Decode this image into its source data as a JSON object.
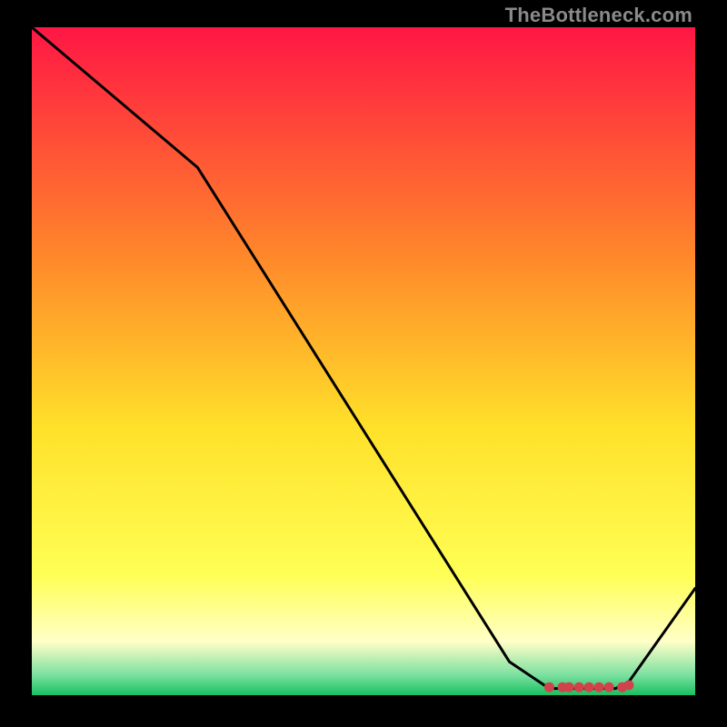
{
  "watermark": "TheBottleneck.com",
  "chart_data": {
    "type": "line",
    "title": "",
    "xlabel": "",
    "ylabel": "",
    "xlim": [
      0,
      100
    ],
    "ylim": [
      0,
      100
    ],
    "grid": false,
    "legend": false,
    "gradient_stops": [
      {
        "offset": 0,
        "color": "#ff1644"
      },
      {
        "offset": 0.35,
        "color": "#ff8a2a"
      },
      {
        "offset": 0.6,
        "color": "#ffe12a"
      },
      {
        "offset": 0.82,
        "color": "#ffff55"
      },
      {
        "offset": 0.92,
        "color": "#ffffc8"
      },
      {
        "offset": 0.97,
        "color": "#7be0a0"
      },
      {
        "offset": 1.0,
        "color": "#18c060"
      }
    ],
    "series": [
      {
        "name": "curve",
        "x": [
          0,
          25,
          72,
          78,
          88,
          90,
          100
        ],
        "y": [
          100,
          79,
          5,
          1,
          1,
          2,
          16
        ]
      }
    ],
    "markers": {
      "name": "bottom-cluster",
      "x": [
        78,
        80,
        81,
        82.5,
        84,
        85.5,
        87,
        89,
        90
      ],
      "y": [
        1.2,
        1.2,
        1.2,
        1.2,
        1.2,
        1.2,
        1.2,
        1.2,
        1.5
      ],
      "color": "#d1434a",
      "radius": 5.5
    }
  }
}
